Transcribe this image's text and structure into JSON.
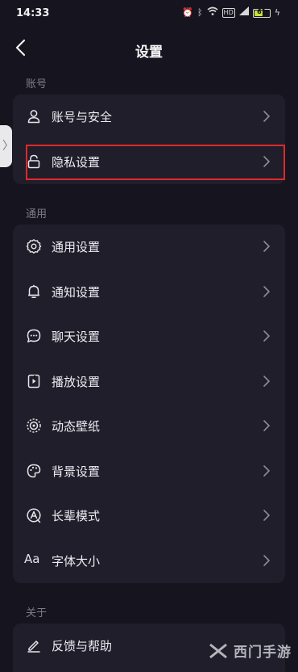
{
  "status_bar": {
    "time": "14:33",
    "battery": "61"
  },
  "header": {
    "title": "设置"
  },
  "sections": {
    "account": {
      "label": "账号",
      "items": [
        {
          "label": "账号与安全",
          "icon": "user-icon"
        },
        {
          "label": "隐私设置",
          "icon": "lock-icon"
        }
      ]
    },
    "general": {
      "label": "通用",
      "items": [
        {
          "label": "通用设置",
          "icon": "gear-icon"
        },
        {
          "label": "通知设置",
          "icon": "bell-icon"
        },
        {
          "label": "聊天设置",
          "icon": "chat-icon"
        },
        {
          "label": "播放设置",
          "icon": "play-device-icon"
        },
        {
          "label": "动态壁纸",
          "icon": "wallpaper-icon"
        },
        {
          "label": "背景设置",
          "icon": "palette-icon"
        },
        {
          "label": "长辈模式",
          "icon": "elder-mode-icon"
        },
        {
          "label": "字体大小",
          "icon": "font-size-icon"
        }
      ]
    },
    "about": {
      "label": "关于",
      "items": [
        {
          "label": "反馈与帮助",
          "icon": "feedback-pen-icon"
        }
      ]
    }
  },
  "accent": {
    "highlight": "#e0282b"
  },
  "watermark": {
    "text": "西门手游"
  }
}
